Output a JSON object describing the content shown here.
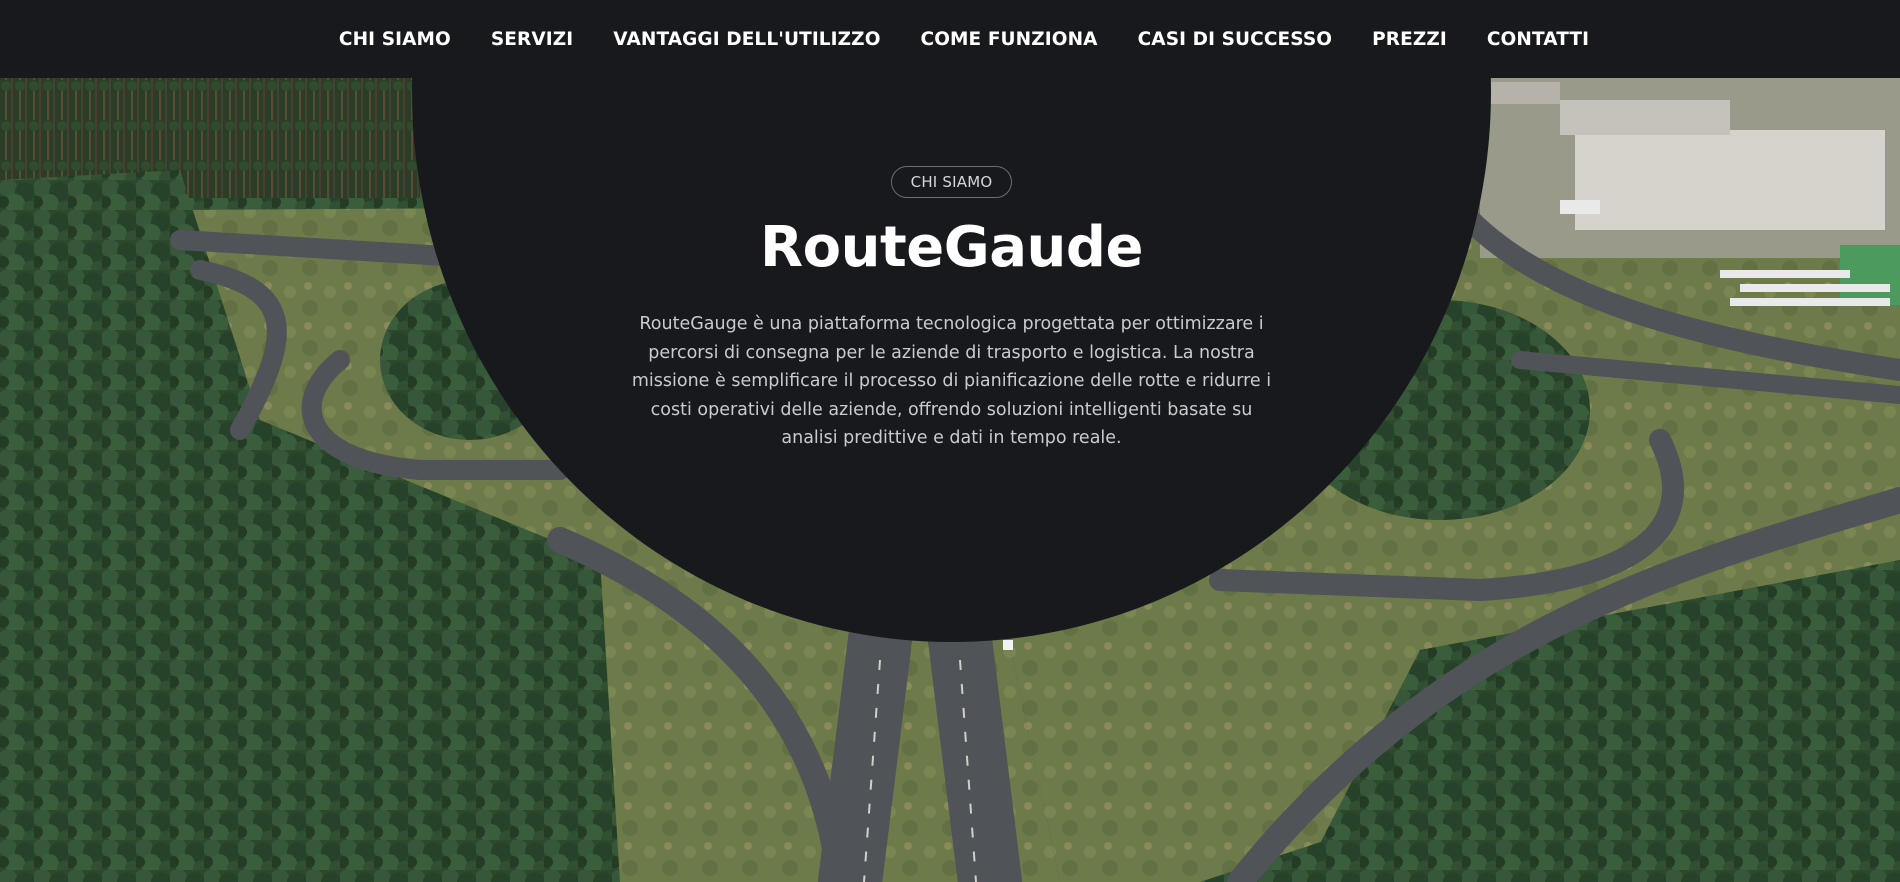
{
  "nav": {
    "items": [
      {
        "label": "CHI SIAMO"
      },
      {
        "label": "SERVIZI"
      },
      {
        "label": "VANTAGGI DELL'UTILIZZO"
      },
      {
        "label": "COME FUNZIONA"
      },
      {
        "label": "CASI DI SUCCESSO"
      },
      {
        "label": "PREZZI"
      },
      {
        "label": "CONTATTI"
      }
    ]
  },
  "hero": {
    "badge": "CHI SIAMO",
    "title": "RouteGaude",
    "description": "RouteGauge è una piattaforma tecnologica progettata per ottimizzare i percorsi di consegna per le aziende di trasporto e logistica. La nostra missione è semplificare il processo di pianificazione delle rotte e ridurre i costi operativi delle aziende, offrendo soluzioni intelligenti basate su analisi predittive e dati in tempo reale.",
    "background_image": "aerial-highway-interchange-forest"
  },
  "colors": {
    "nav_background": "#17191c",
    "circle_background": "#17191c",
    "text_primary": "#ffffff",
    "text_secondary": "#c9cbce",
    "badge_border": "#6b6e72"
  }
}
